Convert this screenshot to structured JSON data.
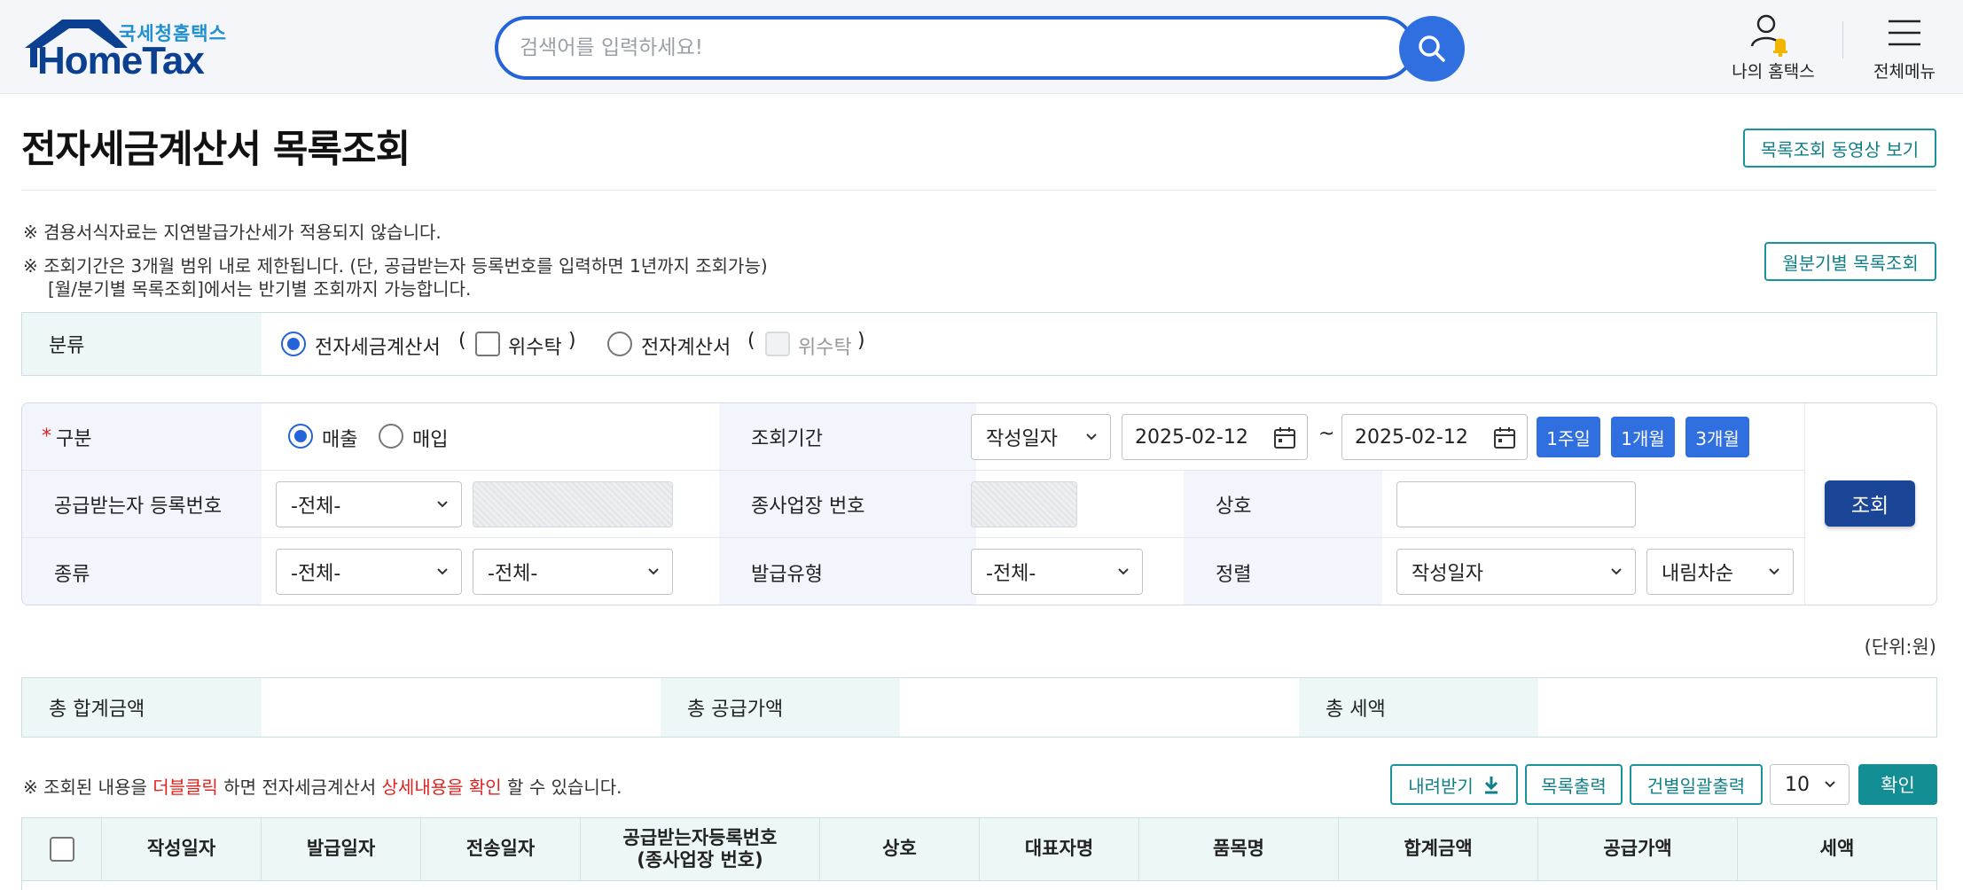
{
  "header": {
    "logo_sub": "국세청홈택스",
    "logo_main": "HomeTax",
    "search_placeholder": "검색어를 입력하세요!",
    "my_hometax": "나의 홈택스",
    "all_menu": "전체메뉴",
    "accent_color": "#2563d8"
  },
  "page": {
    "title": "전자세금계산서 목록조회",
    "video_button": "목록조회 동영상 보기",
    "monthly_button": "월분기별 목록조회",
    "notices": [
      "※ 겸용서식자료는 지연발급가산세가 적용되지 않습니다.",
      "※ 조회기간은 3개월 범위 내로 제한됩니다. (단, 공급받는자 등록번호를 입력하면 1년까지 조회가능)",
      "[월/분기별 목록조회]에서는 반기별 조회까지 가능합니다."
    ]
  },
  "category": {
    "label": "분류",
    "option1": "전자세금계산서",
    "option1_sub": "위수탁",
    "option2": "전자계산서",
    "option2_sub": "위수탁",
    "paren_open": "(",
    "paren_close": ")"
  },
  "search": {
    "required_mark": "*",
    "type_label": "구분",
    "type_sales": "매출",
    "type_purchase": "매입",
    "period_label": "조회기간",
    "period_basis": "작성일자",
    "date_from": "2025-02-12",
    "date_sep": "~",
    "date_to": "2025-02-12",
    "btn_1week": "1주일",
    "btn_1month": "1개월",
    "btn_3month": "3개월",
    "buyer_reg_label": "공급받는자 등록번호",
    "buyer_reg_select": "-전체-",
    "branch_label": "종사업장 번호",
    "company_label": "상호",
    "kind_label": "종류",
    "kind_select1": "-전체-",
    "kind_select2": "-전체-",
    "issue_type_label": "발급유형",
    "issue_type_select": "-전체-",
    "sort_label": "정렬",
    "sort_by": "작성일자",
    "sort_order": "내림차순",
    "query_button": "조회"
  },
  "summary": {
    "unit": "(단위:원)",
    "total_label": "총 합계금액",
    "supply_label": "총 공급가액",
    "tax_label": "총 세액"
  },
  "result": {
    "hint_prefix": "※ 조회된 내용을 ",
    "hint_red1": "더블클릭",
    "hint_mid": " 하면 전자세금계산서 ",
    "hint_red2": "상세내용을 확인",
    "hint_suffix": " 할 수 있습니다.",
    "download_button": "내려받기",
    "print_list_button": "목록출력",
    "print_each_button": "건별일괄출력",
    "page_size": "10",
    "confirm_button": "확인",
    "columns": [
      "작성일자",
      "발급일자",
      "전송일자",
      "공급받는자등록번호",
      "(종사업장 번호)",
      "상호",
      "대표자명",
      "품목명",
      "합계금액",
      "공급가액",
      "세액"
    ]
  }
}
